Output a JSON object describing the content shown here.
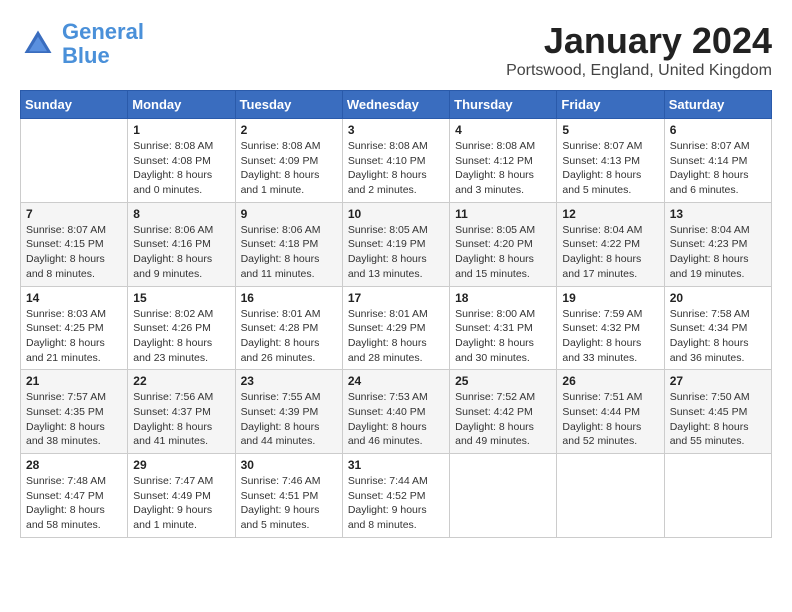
{
  "header": {
    "logo_line1": "General",
    "logo_line2": "Blue",
    "month_title": "January 2024",
    "location": "Portswood, England, United Kingdom"
  },
  "weekdays": [
    "Sunday",
    "Monday",
    "Tuesday",
    "Wednesday",
    "Thursday",
    "Friday",
    "Saturday"
  ],
  "weeks": [
    [
      {
        "day": "",
        "info": ""
      },
      {
        "day": "1",
        "info": "Sunrise: 8:08 AM\nSunset: 4:08 PM\nDaylight: 8 hours\nand 0 minutes."
      },
      {
        "day": "2",
        "info": "Sunrise: 8:08 AM\nSunset: 4:09 PM\nDaylight: 8 hours\nand 1 minute."
      },
      {
        "day": "3",
        "info": "Sunrise: 8:08 AM\nSunset: 4:10 PM\nDaylight: 8 hours\nand 2 minutes."
      },
      {
        "day": "4",
        "info": "Sunrise: 8:08 AM\nSunset: 4:12 PM\nDaylight: 8 hours\nand 3 minutes."
      },
      {
        "day": "5",
        "info": "Sunrise: 8:07 AM\nSunset: 4:13 PM\nDaylight: 8 hours\nand 5 minutes."
      },
      {
        "day": "6",
        "info": "Sunrise: 8:07 AM\nSunset: 4:14 PM\nDaylight: 8 hours\nand 6 minutes."
      }
    ],
    [
      {
        "day": "7",
        "info": "Sunrise: 8:07 AM\nSunset: 4:15 PM\nDaylight: 8 hours\nand 8 minutes."
      },
      {
        "day": "8",
        "info": "Sunrise: 8:06 AM\nSunset: 4:16 PM\nDaylight: 8 hours\nand 9 minutes."
      },
      {
        "day": "9",
        "info": "Sunrise: 8:06 AM\nSunset: 4:18 PM\nDaylight: 8 hours\nand 11 minutes."
      },
      {
        "day": "10",
        "info": "Sunrise: 8:05 AM\nSunset: 4:19 PM\nDaylight: 8 hours\nand 13 minutes."
      },
      {
        "day": "11",
        "info": "Sunrise: 8:05 AM\nSunset: 4:20 PM\nDaylight: 8 hours\nand 15 minutes."
      },
      {
        "day": "12",
        "info": "Sunrise: 8:04 AM\nSunset: 4:22 PM\nDaylight: 8 hours\nand 17 minutes."
      },
      {
        "day": "13",
        "info": "Sunrise: 8:04 AM\nSunset: 4:23 PM\nDaylight: 8 hours\nand 19 minutes."
      }
    ],
    [
      {
        "day": "14",
        "info": "Sunrise: 8:03 AM\nSunset: 4:25 PM\nDaylight: 8 hours\nand 21 minutes."
      },
      {
        "day": "15",
        "info": "Sunrise: 8:02 AM\nSunset: 4:26 PM\nDaylight: 8 hours\nand 23 minutes."
      },
      {
        "day": "16",
        "info": "Sunrise: 8:01 AM\nSunset: 4:28 PM\nDaylight: 8 hours\nand 26 minutes."
      },
      {
        "day": "17",
        "info": "Sunrise: 8:01 AM\nSunset: 4:29 PM\nDaylight: 8 hours\nand 28 minutes."
      },
      {
        "day": "18",
        "info": "Sunrise: 8:00 AM\nSunset: 4:31 PM\nDaylight: 8 hours\nand 30 minutes."
      },
      {
        "day": "19",
        "info": "Sunrise: 7:59 AM\nSunset: 4:32 PM\nDaylight: 8 hours\nand 33 minutes."
      },
      {
        "day": "20",
        "info": "Sunrise: 7:58 AM\nSunset: 4:34 PM\nDaylight: 8 hours\nand 36 minutes."
      }
    ],
    [
      {
        "day": "21",
        "info": "Sunrise: 7:57 AM\nSunset: 4:35 PM\nDaylight: 8 hours\nand 38 minutes."
      },
      {
        "day": "22",
        "info": "Sunrise: 7:56 AM\nSunset: 4:37 PM\nDaylight: 8 hours\nand 41 minutes."
      },
      {
        "day": "23",
        "info": "Sunrise: 7:55 AM\nSunset: 4:39 PM\nDaylight: 8 hours\nand 44 minutes."
      },
      {
        "day": "24",
        "info": "Sunrise: 7:53 AM\nSunset: 4:40 PM\nDaylight: 8 hours\nand 46 minutes."
      },
      {
        "day": "25",
        "info": "Sunrise: 7:52 AM\nSunset: 4:42 PM\nDaylight: 8 hours\nand 49 minutes."
      },
      {
        "day": "26",
        "info": "Sunrise: 7:51 AM\nSunset: 4:44 PM\nDaylight: 8 hours\nand 52 minutes."
      },
      {
        "day": "27",
        "info": "Sunrise: 7:50 AM\nSunset: 4:45 PM\nDaylight: 8 hours\nand 55 minutes."
      }
    ],
    [
      {
        "day": "28",
        "info": "Sunrise: 7:48 AM\nSunset: 4:47 PM\nDaylight: 8 hours\nand 58 minutes."
      },
      {
        "day": "29",
        "info": "Sunrise: 7:47 AM\nSunset: 4:49 PM\nDaylight: 9 hours\nand 1 minute."
      },
      {
        "day": "30",
        "info": "Sunrise: 7:46 AM\nSunset: 4:51 PM\nDaylight: 9 hours\nand 5 minutes."
      },
      {
        "day": "31",
        "info": "Sunrise: 7:44 AM\nSunset: 4:52 PM\nDaylight: 9 hours\nand 8 minutes."
      },
      {
        "day": "",
        "info": ""
      },
      {
        "day": "",
        "info": ""
      },
      {
        "day": "",
        "info": ""
      }
    ]
  ]
}
